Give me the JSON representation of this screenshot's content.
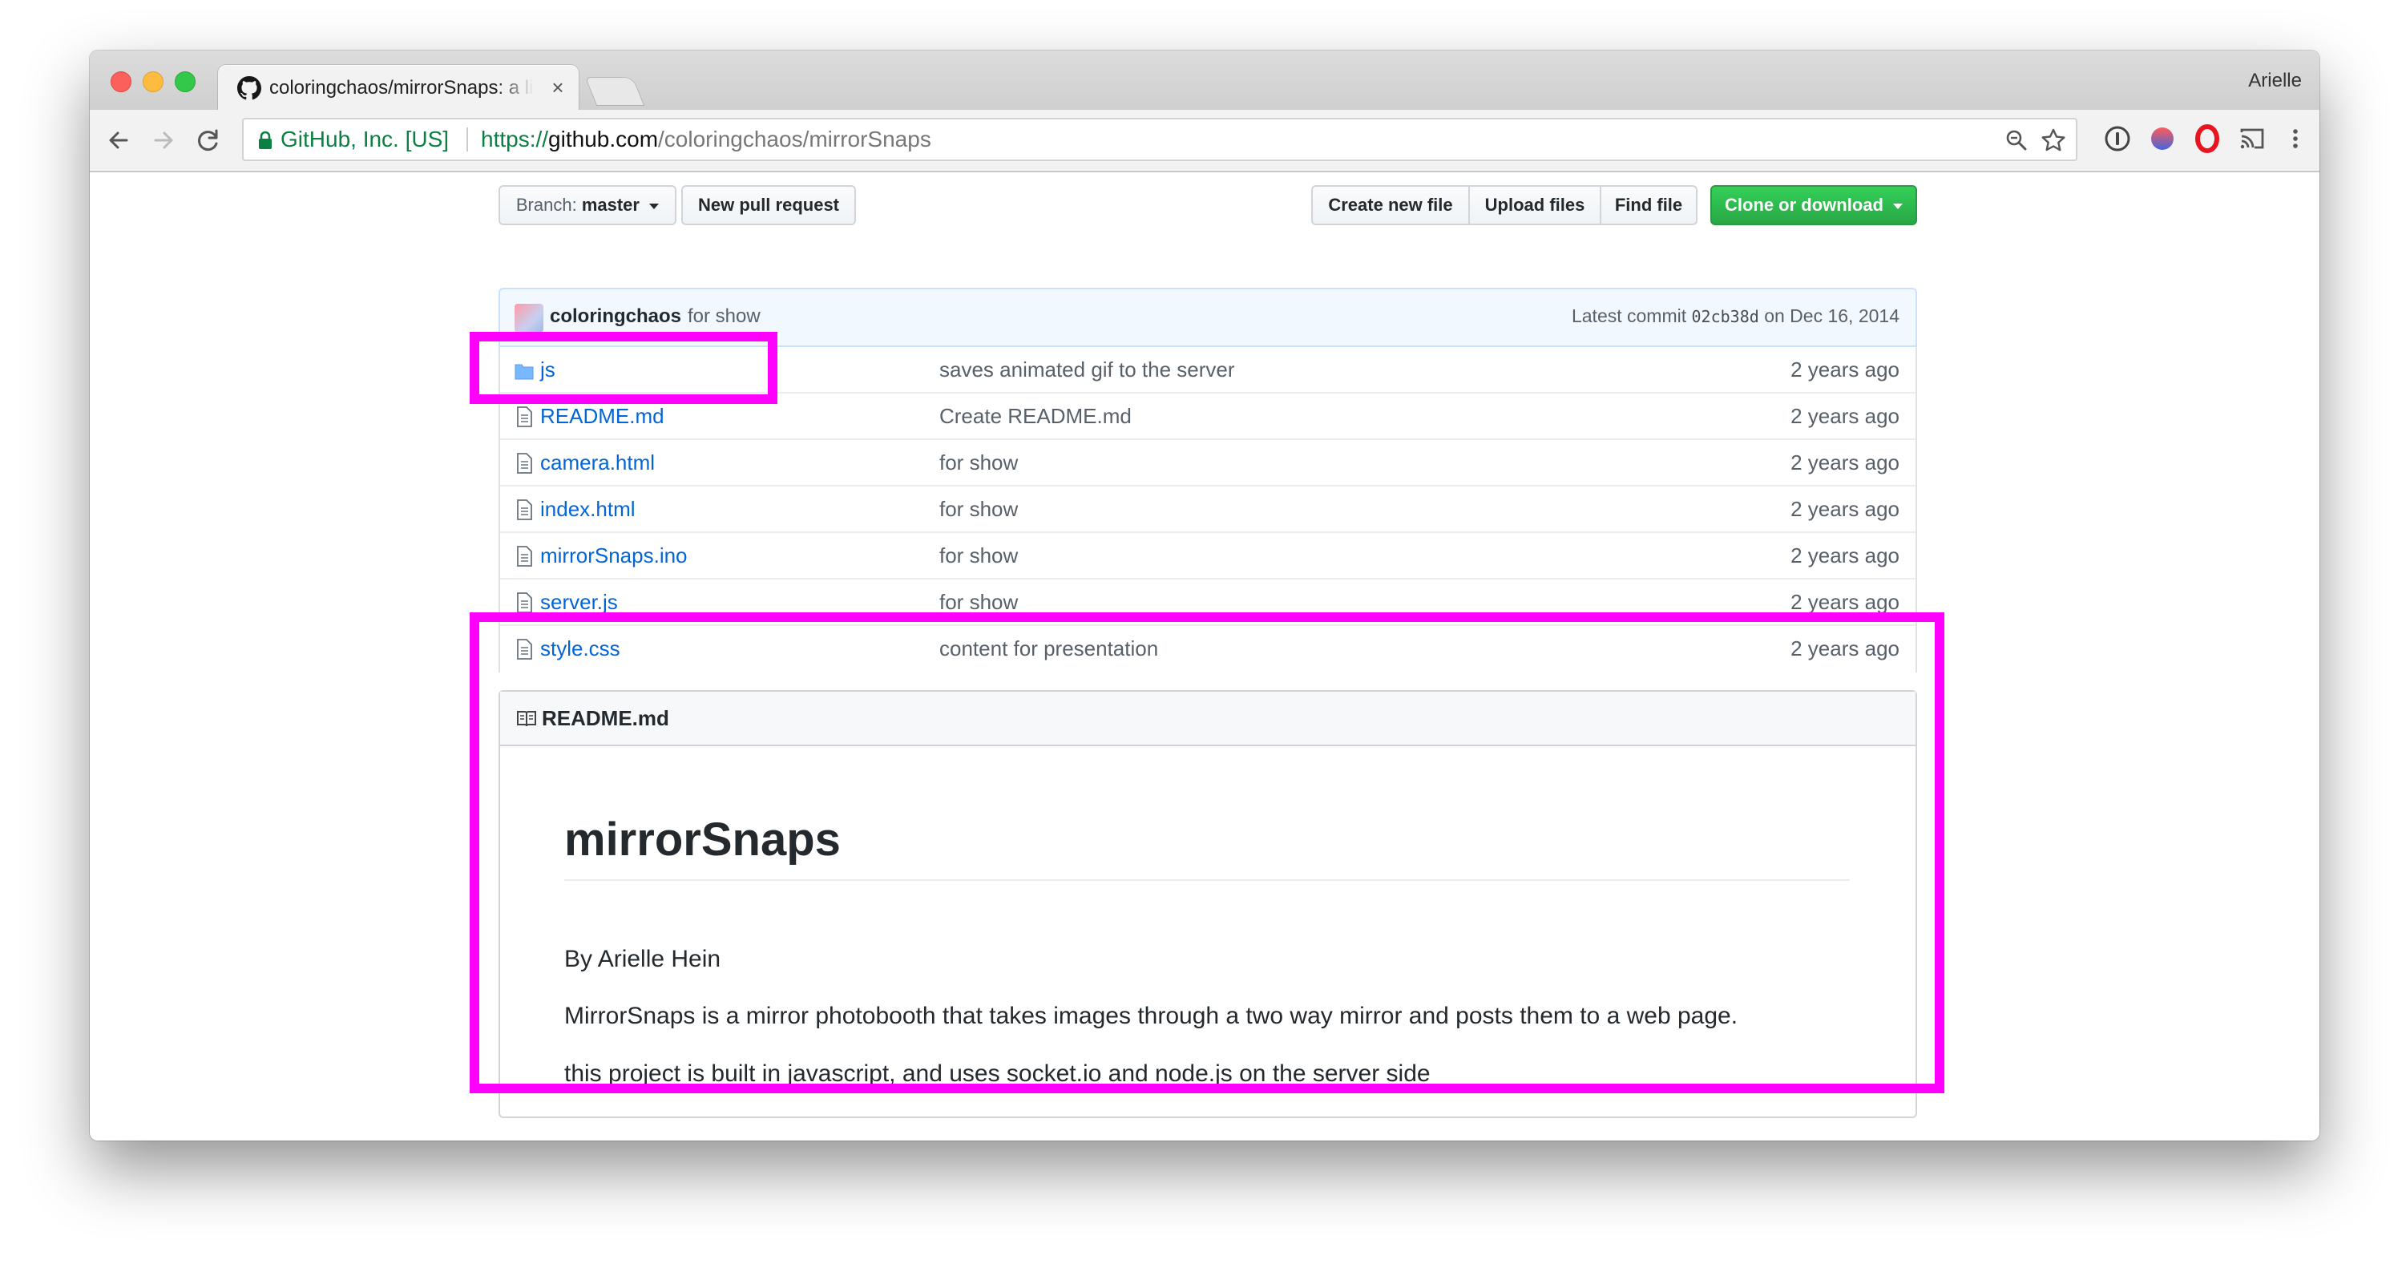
{
  "browser": {
    "tab_title": "coloringchaos/mirrorSnaps: a little magic mirror photobooth",
    "tab_close": "×",
    "profile_name": "Arielle",
    "ev_name": "GitHub, Inc. [US]",
    "url_scheme": "https://",
    "url_host": "github.com",
    "url_path": "/coloringchaos/mirrorSnaps",
    "icons": [
      "back-icon",
      "forward-icon",
      "reload-icon",
      "lock-icon",
      "zoom-icon",
      "star-icon",
      "info-extension-icon",
      "profile-extension-icon",
      "opera-extension-icon",
      "cast-icon",
      "menu-icon"
    ]
  },
  "repo": {
    "branch_label": "Branch:",
    "branch_name": "master",
    "new_pull_request": "New pull request",
    "create_new_file": "Create new file",
    "upload_files": "Upload files",
    "find_file": "Find file",
    "clone_or_download": "Clone or download",
    "colors": {
      "link": "#0366d6",
      "green": "#28a745",
      "annotation": "#ff00ff"
    }
  },
  "commit": {
    "author": "coloringchaos",
    "message": "for show",
    "latest_label": "Latest commit",
    "sha": "02cb38d",
    "date_text": "on Dec 16, 2014"
  },
  "files": [
    {
      "name": "js",
      "type": "folder",
      "message": "saves animated gif to the server",
      "age": "2 years ago"
    },
    {
      "name": "README.md",
      "type": "file",
      "message": "Create README.md",
      "age": "2 years ago"
    },
    {
      "name": "camera.html",
      "type": "file",
      "message": "for show",
      "age": "2 years ago"
    },
    {
      "name": "index.html",
      "type": "file",
      "message": "for show",
      "age": "2 years ago"
    },
    {
      "name": "mirrorSnaps.ino",
      "type": "file",
      "message": "for show",
      "age": "2 years ago"
    },
    {
      "name": "server.js",
      "type": "file",
      "message": "for show",
      "age": "2 years ago"
    },
    {
      "name": "style.css",
      "type": "file",
      "message": "content for presentation",
      "age": "2 years ago"
    }
  ],
  "readme": {
    "header_title": "README.md",
    "h1": "mirrorSnaps",
    "p1": "By Arielle Hein",
    "p2": "MirrorSnaps is a mirror photobooth that takes images through a two way mirror and posts them to a web page.",
    "p3": "this project is built in javascript, and uses socket.io and node.js on the server side"
  }
}
